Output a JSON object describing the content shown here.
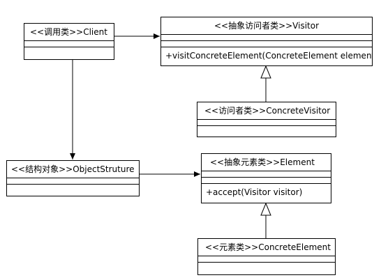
{
  "classes": {
    "client": {
      "name": "<<调用类>>Client"
    },
    "visitor": {
      "name": "<<抽象访问者类>>Visitor",
      "operation": "+visitConcreteElement(ConcreteElement element)"
    },
    "concrete_visitor": {
      "name": "<<访问者类>>ConcreteVisitor"
    },
    "object_structure": {
      "name": "<<结构对象>>ObjectStruture"
    },
    "element": {
      "name": "<<抽象元素类>>Element",
      "operation": "+accept(Visitor visitor)"
    },
    "concrete_element": {
      "name": "<<元素类>>ConcreteElement"
    }
  },
  "relations": [
    {
      "from": "Client",
      "to": "Visitor",
      "type": "association"
    },
    {
      "from": "Client",
      "to": "ObjectStruture",
      "type": "association"
    },
    {
      "from": "ConcreteVisitor",
      "to": "Visitor",
      "type": "generalization"
    },
    {
      "from": "ObjectStruture",
      "to": "Element",
      "type": "association"
    },
    {
      "from": "ConcreteElement",
      "to": "Element",
      "type": "generalization"
    }
  ],
  "colors": {
    "line": "#000000",
    "background": "#ffffff"
  }
}
